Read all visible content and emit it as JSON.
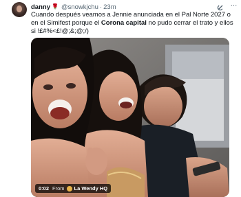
{
  "tweet": {
    "author": {
      "display_name": "danny",
      "name_icon": "rose-icon",
      "handle": "@snowkjchu",
      "separator": "·",
      "time": "23m"
    },
    "text": {
      "part1": "Cuando después veamos a Jennie anunciada en el Pal Norte 2027 o en el Simifest porque el ",
      "bold": "Corona capital",
      "part2": " no pudo cerrar el trato y ellos si !£#%<£!@;&;@;/)"
    },
    "media": {
      "type": "video",
      "duration": "0:02",
      "from_label": "From",
      "source_icon": "source-avatar-icon",
      "source_name": "La Wendy HQ"
    },
    "icons": {
      "grok": "grok-icon",
      "more": "more-icon"
    }
  }
}
